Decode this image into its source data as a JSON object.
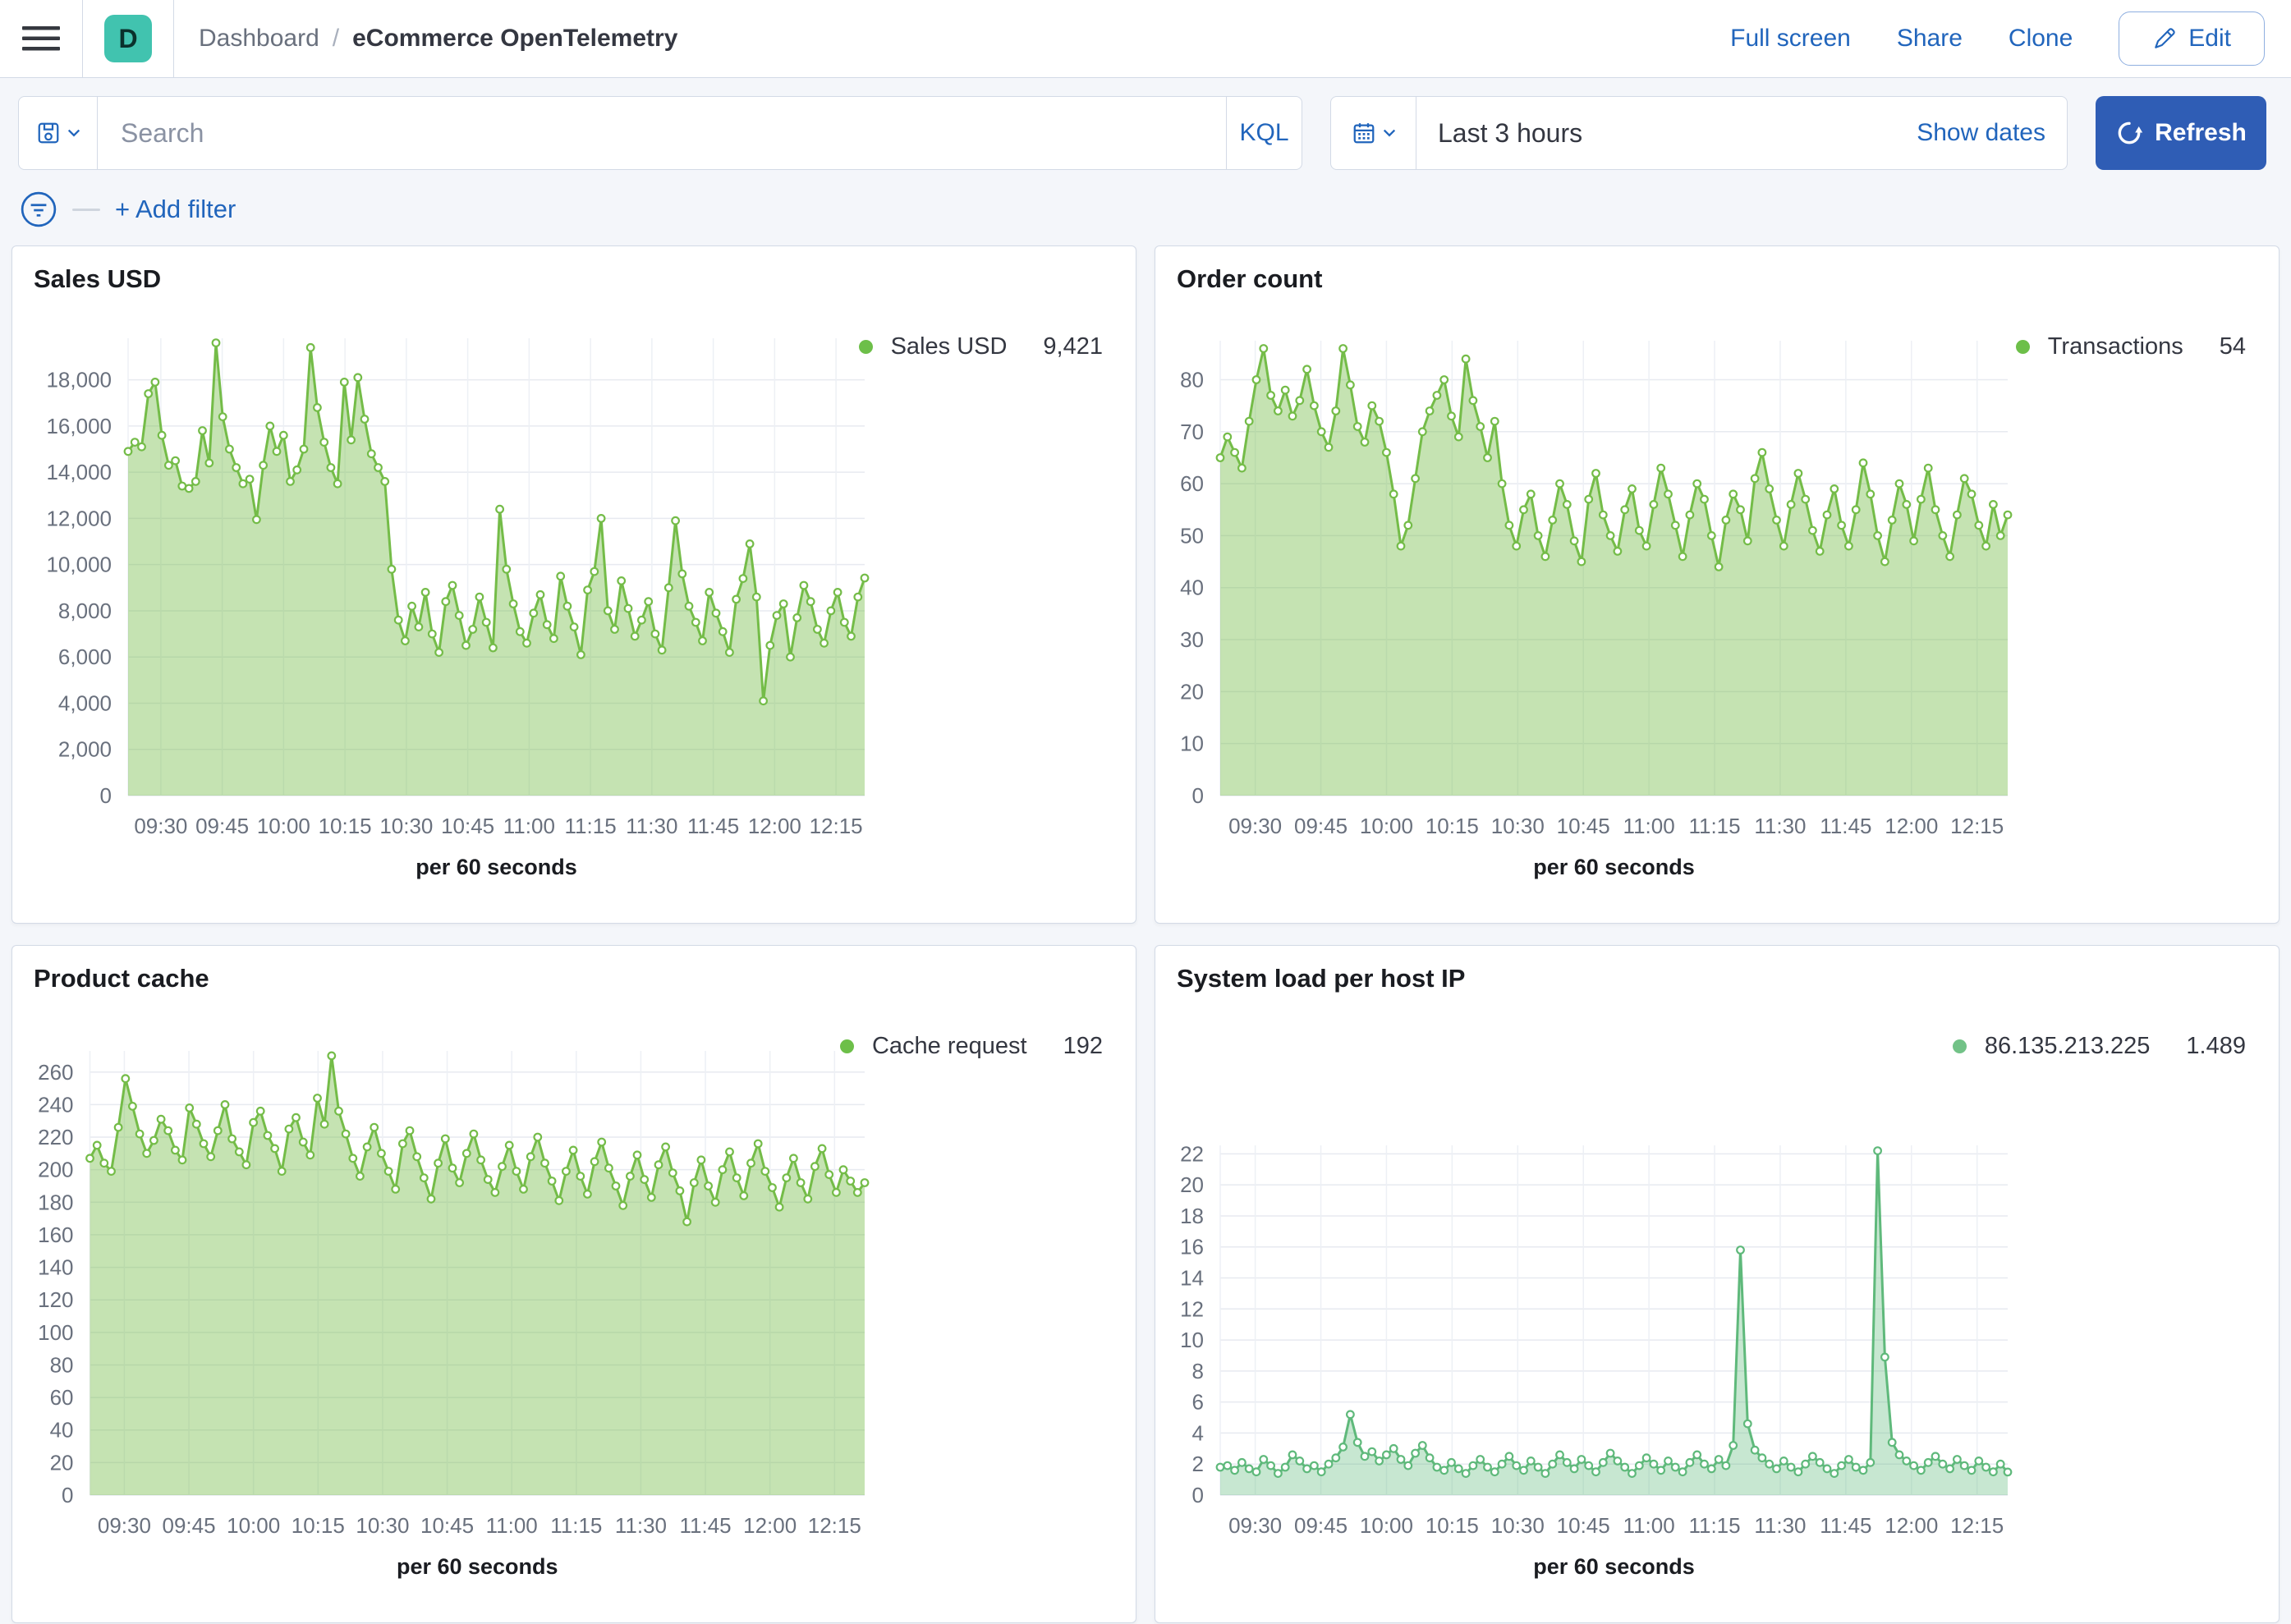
{
  "header": {
    "space_initial": "D",
    "breadcrumb": {
      "root": "Dashboard",
      "separator": "/",
      "current": "eCommerce OpenTelemetry"
    },
    "actions": {
      "full_screen": "Full screen",
      "share": "Share",
      "clone": "Clone",
      "edit": "Edit"
    }
  },
  "query_bar": {
    "search_placeholder": "Search",
    "query_language": "KQL",
    "time_range": "Last 3 hours",
    "show_dates_label": "Show dates",
    "refresh_label": "Refresh"
  },
  "filter_bar": {
    "add_filter_label": "+ Add filter"
  },
  "colors": {
    "accent_link": "#2165bc",
    "refresh_button": "#2f5db5",
    "space_badge": "#41c3af",
    "series_green": "#74bc48",
    "series_teal_green": "#5fb97b"
  },
  "chart_data": [
    {
      "type": "area",
      "title": "Sales USD",
      "color_line": "#74bc48",
      "color_fill": "rgba(116,188,72,0.42)",
      "color_dot": "#6dbf49",
      "x": {
        "tick_labels": [
          "09:30",
          "09:45",
          "10:00",
          "10:15",
          "10:30",
          "10:45",
          "11:00",
          "11:15",
          "11:30",
          "11:45",
          "12:00",
          "12:15"
        ],
        "tick_minutes": [
          8,
          23,
          38,
          53,
          68,
          83,
          98,
          113,
          128,
          143,
          158,
          173
        ],
        "span_minutes": 180,
        "axis_title": "per 60 seconds"
      },
      "y": {
        "labels": [
          "0",
          "2,000",
          "4,000",
          "6,000",
          "8,000",
          "10,000",
          "12,000",
          "14,000",
          "16,000",
          "18,000"
        ],
        "step": 2000,
        "max_plot": 19800
      },
      "series": [
        {
          "name": "Sales USD",
          "current_value": "9,421",
          "values": [
            14900,
            15300,
            15100,
            17400,
            17900,
            15600,
            14300,
            14500,
            13400,
            13300,
            13600,
            15800,
            14400,
            19600,
            16400,
            15000,
            14200,
            13500,
            13700,
            11950,
            14300,
            16000,
            14900,
            15600,
            13600,
            14100,
            15000,
            19400,
            16800,
            15300,
            14200,
            13500,
            17900,
            15400,
            18100,
            16300,
            14800,
            14200,
            13600,
            9800,
            7600,
            6700,
            8200,
            7300,
            8800,
            7000,
            6200,
            8400,
            9100,
            7800,
            6500,
            7200,
            8600,
            7500,
            6400,
            12400,
            9800,
            8300,
            7100,
            6600,
            7900,
            8700,
            7400,
            6800,
            9500,
            8200,
            7300,
            6100,
            8900,
            9700,
            12000,
            8000,
            7200,
            9300,
            8100,
            6900,
            7600,
            8400,
            7000,
            6300,
            9000,
            11900,
            9600,
            8200,
            7500,
            6700,
            8800,
            7900,
            7100,
            6200,
            8500,
            9400,
            10900,
            8600,
            4100,
            6500,
            7800,
            8300,
            6000,
            7700,
            9100,
            8400,
            7200,
            6600,
            8000,
            8800,
            7500,
            6900,
            8600,
            9421
          ]
        }
      ]
    },
    {
      "type": "area",
      "title": "Order count",
      "color_line": "#74bc48",
      "color_fill": "rgba(116,188,72,0.42)",
      "color_dot": "#6dbf49",
      "x": {
        "tick_labels": [
          "09:30",
          "09:45",
          "10:00",
          "10:15",
          "10:30",
          "10:45",
          "11:00",
          "11:15",
          "11:30",
          "11:45",
          "12:00",
          "12:15"
        ],
        "tick_minutes": [
          8,
          23,
          38,
          53,
          68,
          83,
          98,
          113,
          128,
          143,
          158,
          173
        ],
        "span_minutes": 180,
        "axis_title": "per 60 seconds"
      },
      "y": {
        "labels": [
          "0",
          "10",
          "20",
          "30",
          "40",
          "50",
          "60",
          "70",
          "80"
        ],
        "step": 10,
        "max_plot": 87.5
      },
      "series": [
        {
          "name": "Transactions",
          "current_value": "54",
          "values": [
            65,
            69,
            66,
            63,
            72,
            80,
            86,
            77,
            74,
            78,
            73,
            76,
            82,
            75,
            70,
            67,
            74,
            86,
            79,
            71,
            68,
            75,
            72,
            66,
            58,
            48,
            52,
            61,
            70,
            74,
            77,
            80,
            73,
            69,
            84,
            76,
            71,
            65,
            72,
            60,
            52,
            48,
            55,
            58,
            50,
            46,
            53,
            60,
            56,
            49,
            45,
            57,
            62,
            54,
            50,
            47,
            55,
            59,
            51,
            48,
            56,
            63,
            58,
            52,
            46,
            54,
            60,
            57,
            50,
            44,
            53,
            58,
            55,
            49,
            61,
            66,
            59,
            53,
            48,
            56,
            62,
            57,
            51,
            47,
            54,
            59,
            52,
            48,
            55,
            64,
            58,
            50,
            45,
            53,
            60,
            56,
            49,
            57,
            63,
            55,
            50,
            46,
            54,
            61,
            58,
            52,
            48,
            56,
            50,
            54
          ]
        }
      ]
    },
    {
      "type": "area",
      "title": "Product cache",
      "color_line": "#74bc48",
      "color_fill": "rgba(116,188,72,0.42)",
      "color_dot": "#6dbf49",
      "x": {
        "tick_labels": [
          "09:30",
          "09:45",
          "10:00",
          "10:15",
          "10:30",
          "10:45",
          "11:00",
          "11:15",
          "11:30",
          "11:45",
          "12:00",
          "12:15"
        ],
        "tick_minutes": [
          8,
          23,
          38,
          53,
          68,
          83,
          98,
          113,
          128,
          143,
          158,
          173
        ],
        "span_minutes": 180,
        "axis_title": "per 60 seconds"
      },
      "y": {
        "labels": [
          "0",
          "20",
          "40",
          "60",
          "80",
          "100",
          "120",
          "140",
          "160",
          "180",
          "200",
          "220",
          "240",
          "260"
        ],
        "step": 20,
        "max_plot": 273
      },
      "series": [
        {
          "name": "Cache request",
          "current_value": "192",
          "values": [
            207,
            215,
            204,
            199,
            226,
            256,
            239,
            222,
            210,
            218,
            231,
            224,
            212,
            206,
            238,
            228,
            216,
            208,
            224,
            240,
            219,
            211,
            203,
            229,
            236,
            221,
            213,
            199,
            225,
            232,
            217,
            209,
            244,
            228,
            270,
            236,
            222,
            207,
            196,
            214,
            226,
            210,
            199,
            188,
            216,
            224,
            208,
            195,
            182,
            204,
            219,
            201,
            192,
            210,
            222,
            206,
            194,
            186,
            202,
            215,
            199,
            188,
            208,
            220,
            204,
            193,
            181,
            199,
            212,
            196,
            185,
            205,
            217,
            201,
            190,
            178,
            196,
            209,
            194,
            183,
            203,
            214,
            198,
            187,
            168,
            192,
            206,
            190,
            180,
            200,
            211,
            195,
            184,
            204,
            216,
            199,
            189,
            177,
            195,
            207,
            192,
            182,
            202,
            213,
            197,
            186,
            200,
            193,
            186,
            192
          ]
        }
      ]
    },
    {
      "type": "area",
      "title": "System load per host IP",
      "color_line": "#5fb97b",
      "color_fill": "rgba(95,185,123,0.35)",
      "color_dot": "#72c287",
      "x": {
        "tick_labels": [
          "09:30",
          "09:45",
          "10:00",
          "10:15",
          "10:30",
          "10:45",
          "11:00",
          "11:15",
          "11:30",
          "11:45",
          "12:00",
          "12:15"
        ],
        "tick_minutes": [
          8,
          23,
          38,
          53,
          68,
          83,
          98,
          113,
          128,
          143,
          158,
          173
        ],
        "span_minutes": 180,
        "axis_title": "per 60 seconds"
      },
      "y": {
        "labels": [
          "0",
          "2",
          "4",
          "6",
          "8",
          "10",
          "12",
          "14",
          "16",
          "18",
          "20",
          "22"
        ],
        "step": 2,
        "max_plot": 22.55
      },
      "series": [
        {
          "name": "86.135.213.225",
          "current_value": "1.489",
          "values": [
            1.8,
            1.9,
            1.6,
            2.1,
            1.7,
            1.5,
            2.3,
            1.9,
            1.4,
            1.8,
            2.6,
            2.2,
            1.7,
            1.9,
            1.5,
            2.0,
            2.4,
            3.1,
            5.2,
            3.4,
            2.5,
            2.8,
            2.2,
            2.6,
            3.0,
            2.3,
            1.9,
            2.7,
            3.2,
            2.4,
            1.8,
            1.6,
            2.1,
            1.7,
            1.4,
            1.9,
            2.3,
            1.8,
            1.5,
            2.0,
            2.5,
            1.9,
            1.6,
            2.2,
            1.8,
            1.4,
            2.0,
            2.6,
            2.1,
            1.7,
            2.3,
            1.9,
            1.5,
            2.1,
            2.7,
            2.2,
            1.8,
            1.4,
            1.9,
            2.4,
            2.0,
            1.6,
            2.2,
            1.8,
            1.5,
            2.1,
            2.6,
            2.0,
            1.7,
            2.3,
            1.9,
            3.2,
            15.8,
            4.6,
            2.9,
            2.4,
            2.0,
            1.7,
            2.2,
            1.8,
            1.5,
            2.0,
            2.5,
            2.1,
            1.7,
            1.4,
            1.9,
            2.3,
            1.8,
            1.6,
            2.1,
            22.2,
            8.9,
            3.4,
            2.6,
            2.2,
            1.9,
            1.6,
            2.1,
            2.5,
            2.0,
            1.7,
            2.3,
            1.9,
            1.6,
            2.2,
            1.8,
            1.5,
            2.0,
            1.489
          ]
        }
      ]
    }
  ]
}
